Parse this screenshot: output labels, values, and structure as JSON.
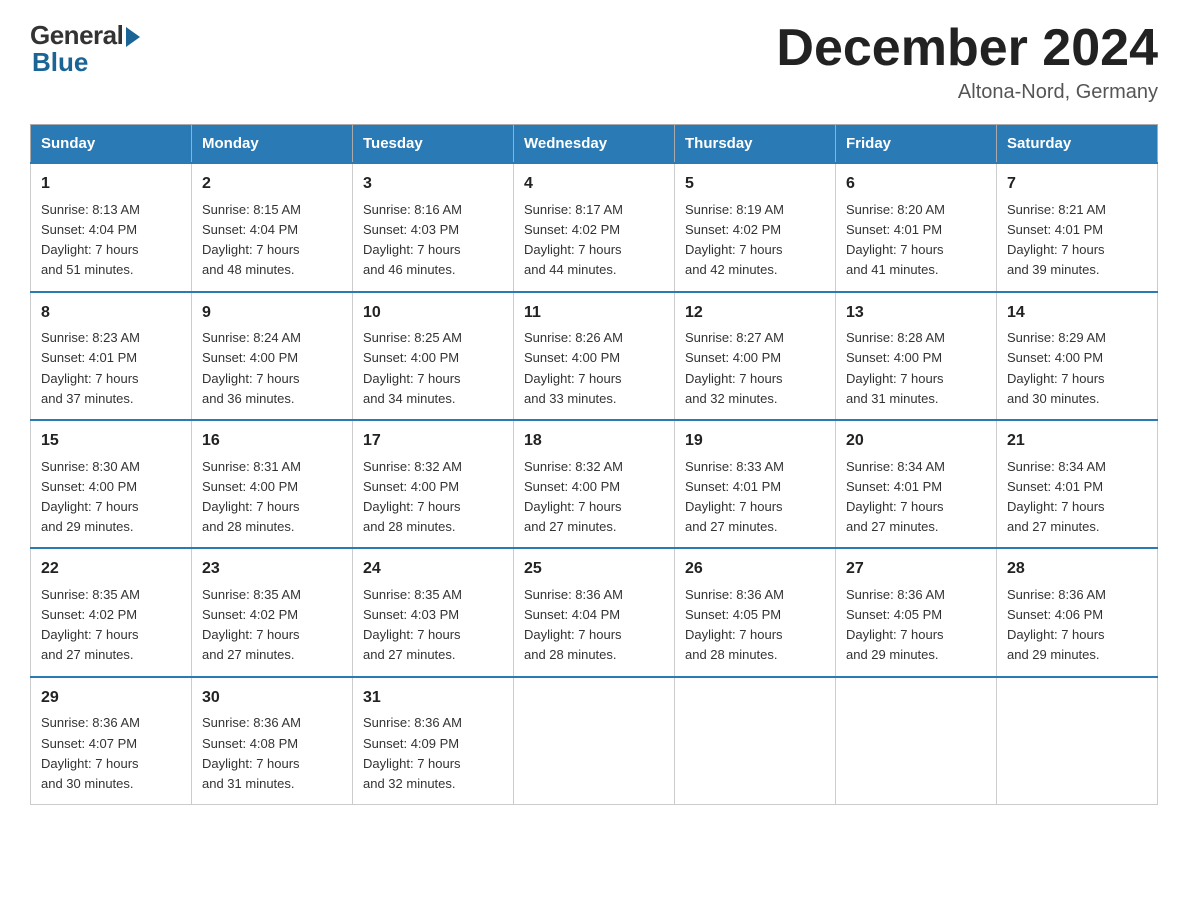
{
  "logo": {
    "general": "General",
    "blue": "Blue"
  },
  "title": {
    "month": "December 2024",
    "location": "Altona-Nord, Germany"
  },
  "header_days": [
    "Sunday",
    "Monday",
    "Tuesday",
    "Wednesday",
    "Thursday",
    "Friday",
    "Saturday"
  ],
  "weeks": [
    [
      {
        "day": "1",
        "info": "Sunrise: 8:13 AM\nSunset: 4:04 PM\nDaylight: 7 hours\nand 51 minutes."
      },
      {
        "day": "2",
        "info": "Sunrise: 8:15 AM\nSunset: 4:04 PM\nDaylight: 7 hours\nand 48 minutes."
      },
      {
        "day": "3",
        "info": "Sunrise: 8:16 AM\nSunset: 4:03 PM\nDaylight: 7 hours\nand 46 minutes."
      },
      {
        "day": "4",
        "info": "Sunrise: 8:17 AM\nSunset: 4:02 PM\nDaylight: 7 hours\nand 44 minutes."
      },
      {
        "day": "5",
        "info": "Sunrise: 8:19 AM\nSunset: 4:02 PM\nDaylight: 7 hours\nand 42 minutes."
      },
      {
        "day": "6",
        "info": "Sunrise: 8:20 AM\nSunset: 4:01 PM\nDaylight: 7 hours\nand 41 minutes."
      },
      {
        "day": "7",
        "info": "Sunrise: 8:21 AM\nSunset: 4:01 PM\nDaylight: 7 hours\nand 39 minutes."
      }
    ],
    [
      {
        "day": "8",
        "info": "Sunrise: 8:23 AM\nSunset: 4:01 PM\nDaylight: 7 hours\nand 37 minutes."
      },
      {
        "day": "9",
        "info": "Sunrise: 8:24 AM\nSunset: 4:00 PM\nDaylight: 7 hours\nand 36 minutes."
      },
      {
        "day": "10",
        "info": "Sunrise: 8:25 AM\nSunset: 4:00 PM\nDaylight: 7 hours\nand 34 minutes."
      },
      {
        "day": "11",
        "info": "Sunrise: 8:26 AM\nSunset: 4:00 PM\nDaylight: 7 hours\nand 33 minutes."
      },
      {
        "day": "12",
        "info": "Sunrise: 8:27 AM\nSunset: 4:00 PM\nDaylight: 7 hours\nand 32 minutes."
      },
      {
        "day": "13",
        "info": "Sunrise: 8:28 AM\nSunset: 4:00 PM\nDaylight: 7 hours\nand 31 minutes."
      },
      {
        "day": "14",
        "info": "Sunrise: 8:29 AM\nSunset: 4:00 PM\nDaylight: 7 hours\nand 30 minutes."
      }
    ],
    [
      {
        "day": "15",
        "info": "Sunrise: 8:30 AM\nSunset: 4:00 PM\nDaylight: 7 hours\nand 29 minutes."
      },
      {
        "day": "16",
        "info": "Sunrise: 8:31 AM\nSunset: 4:00 PM\nDaylight: 7 hours\nand 28 minutes."
      },
      {
        "day": "17",
        "info": "Sunrise: 8:32 AM\nSunset: 4:00 PM\nDaylight: 7 hours\nand 28 minutes."
      },
      {
        "day": "18",
        "info": "Sunrise: 8:32 AM\nSunset: 4:00 PM\nDaylight: 7 hours\nand 27 minutes."
      },
      {
        "day": "19",
        "info": "Sunrise: 8:33 AM\nSunset: 4:01 PM\nDaylight: 7 hours\nand 27 minutes."
      },
      {
        "day": "20",
        "info": "Sunrise: 8:34 AM\nSunset: 4:01 PM\nDaylight: 7 hours\nand 27 minutes."
      },
      {
        "day": "21",
        "info": "Sunrise: 8:34 AM\nSunset: 4:01 PM\nDaylight: 7 hours\nand 27 minutes."
      }
    ],
    [
      {
        "day": "22",
        "info": "Sunrise: 8:35 AM\nSunset: 4:02 PM\nDaylight: 7 hours\nand 27 minutes."
      },
      {
        "day": "23",
        "info": "Sunrise: 8:35 AM\nSunset: 4:02 PM\nDaylight: 7 hours\nand 27 minutes."
      },
      {
        "day": "24",
        "info": "Sunrise: 8:35 AM\nSunset: 4:03 PM\nDaylight: 7 hours\nand 27 minutes."
      },
      {
        "day": "25",
        "info": "Sunrise: 8:36 AM\nSunset: 4:04 PM\nDaylight: 7 hours\nand 28 minutes."
      },
      {
        "day": "26",
        "info": "Sunrise: 8:36 AM\nSunset: 4:05 PM\nDaylight: 7 hours\nand 28 minutes."
      },
      {
        "day": "27",
        "info": "Sunrise: 8:36 AM\nSunset: 4:05 PM\nDaylight: 7 hours\nand 29 minutes."
      },
      {
        "day": "28",
        "info": "Sunrise: 8:36 AM\nSunset: 4:06 PM\nDaylight: 7 hours\nand 29 minutes."
      }
    ],
    [
      {
        "day": "29",
        "info": "Sunrise: 8:36 AM\nSunset: 4:07 PM\nDaylight: 7 hours\nand 30 minutes."
      },
      {
        "day": "30",
        "info": "Sunrise: 8:36 AM\nSunset: 4:08 PM\nDaylight: 7 hours\nand 31 minutes."
      },
      {
        "day": "31",
        "info": "Sunrise: 8:36 AM\nSunset: 4:09 PM\nDaylight: 7 hours\nand 32 minutes."
      },
      null,
      null,
      null,
      null
    ]
  ]
}
